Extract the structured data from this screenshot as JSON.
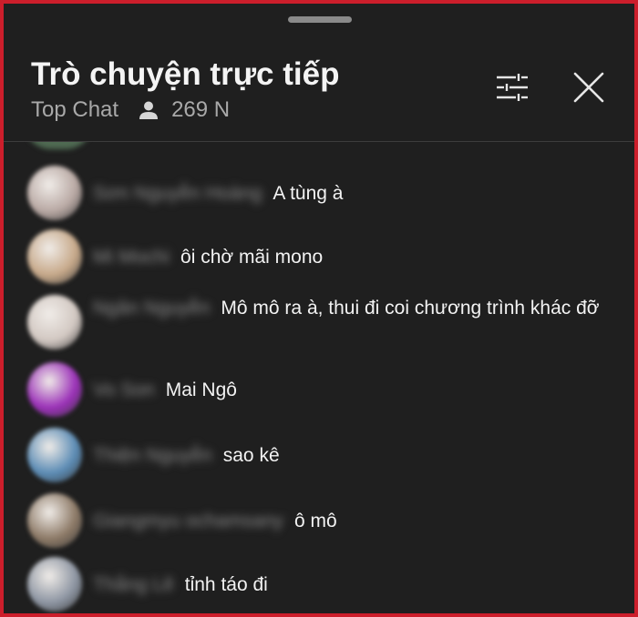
{
  "header": {
    "title": "Trò chuyện trực tiếp",
    "mode_label": "Top Chat",
    "viewer_count": "269 N"
  },
  "icons": {
    "filter": "sliders-icon",
    "close": "close-icon",
    "viewers": "person-icon"
  },
  "messages": [
    {
      "author": "Sơn Nguyễn Hoàng",
      "text": "A tùng à",
      "avatar_color": "#b9a9a4"
    },
    {
      "author": "Mi Mochi",
      "text": "ôi chờ mãi mono",
      "avatar_color": "#c7a98a"
    },
    {
      "author": "Ngân Nguyễn",
      "text": "Mô mô ra à, thui đi coi chương trình khác đỡ",
      "avatar_color": "#d2c8c2"
    },
    {
      "author": "Vo Son",
      "text": "Mai Ngô",
      "avatar_color": "#9b31b8"
    },
    {
      "author": "Thiện Nguyễn",
      "text": "sao kê",
      "avatar_color": "#5c8cb5"
    },
    {
      "author": "Giangmyu ochamsany",
      "text": "ô mô",
      "avatar_color": "#8d7a67"
    },
    {
      "author": "Thắng Lê",
      "text": "tỉnh táo đi",
      "avatar_color": "#8e96a3"
    }
  ]
}
